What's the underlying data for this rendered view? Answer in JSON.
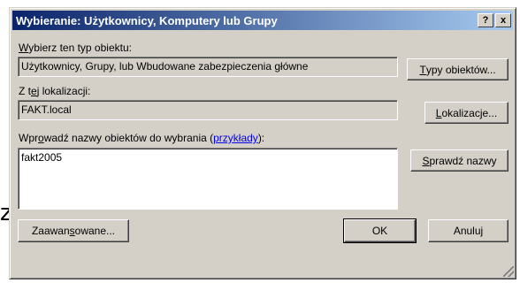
{
  "backdrop": {
    "glyph": "z"
  },
  "window": {
    "title": "Wybieranie: Użytkownicy, Komputery lub Grupy",
    "help_button": "?",
    "close_button": "x"
  },
  "object_type": {
    "label_pre": "",
    "label_key": "W",
    "label_post": "ybierz ten typ obiektu:",
    "value": "Użytkownicy, Grupy, lub Wbudowane zabezpieczenia główne",
    "button_pre": "",
    "button_key": "T",
    "button_post": "ypy obiektów..."
  },
  "location": {
    "label_pre": "Z t",
    "label_key": "e",
    "label_post": "j lokalizacji:",
    "value": "FAKT.local",
    "button_pre": "",
    "button_key": "L",
    "button_post": "okalizacje..."
  },
  "names": {
    "label_pre": "Wpr",
    "label_key": "o",
    "label_post": "wadź nazwy obiektów do wybrania (",
    "link": "przykłady",
    "label_end": "):",
    "value": "fakt2005",
    "check_pre": "",
    "check_key": "S",
    "check_post": "prawdź nazwy"
  },
  "footer": {
    "advanced_pre": "Zaawan",
    "advanced_key": "s",
    "advanced_post": "owane...",
    "ok": "OK",
    "cancel": "Anuluj"
  }
}
